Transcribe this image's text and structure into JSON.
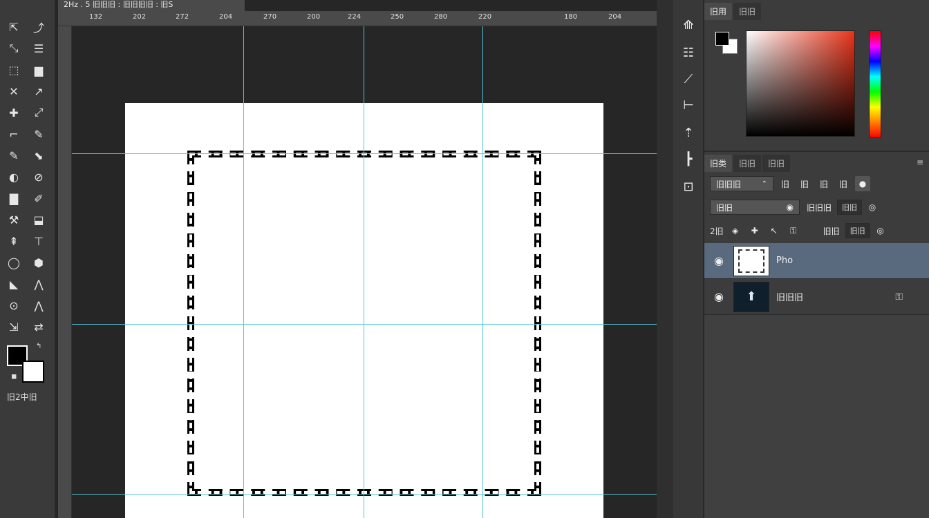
{
  "document": {
    "tab_title": "2Hz . 5 旧旧旧 : 旧旧旧旧 : 旧S"
  },
  "rulers": {
    "top_labels": [
      "132",
      "202",
      "272",
      "204",
      "270",
      "200",
      "224",
      "250",
      "280",
      "220",
      "180",
      "204"
    ]
  },
  "toolbar": {
    "tools_left": [
      "⇱",
      "⤡",
      "⬚",
      "✕",
      "✚",
      "⌐",
      "✎",
      "◐",
      "▇",
      "⚒",
      "⇞",
      "◯",
      "◣",
      "⊙",
      "⇲"
    ],
    "tools_right": [
      "⤴",
      "☰",
      "▆",
      "↗",
      "⤢",
      "✎",
      "⬊",
      "⊘",
      "✐",
      "⬓",
      "⊤",
      "⬢",
      "⋀",
      "⋀",
      "⇄"
    ],
    "quick_mask_label": "旧2中旧"
  },
  "colors": {
    "foreground": "#000000",
    "background": "#ffffff",
    "guide": "#52c8d8",
    "selected_layer": "#5a6a7e"
  },
  "icon_column": {
    "buttons": [
      "⟰",
      "☷",
      "⟋",
      "⊢",
      "⇡",
      "┣",
      "⊡"
    ]
  },
  "color_panel": {
    "tabs": [
      "旧用",
      "旧旧"
    ]
  },
  "layers_panel": {
    "tabs": [
      "旧类",
      "旧旧",
      "旧旧"
    ],
    "menu_icon": "≡",
    "kind_filter": "旧旧旧",
    "filter_icons": [
      "旧",
      "旧",
      "旧",
      "旧"
    ],
    "blend_mode": "旧旧",
    "opacity_label": "旧旧旧",
    "opacity_value": "旧旧",
    "lock_label": "2旧",
    "lock_icons": [
      "◈",
      "✚",
      "↖",
      "⚿"
    ],
    "fill_label": "旧旧",
    "fill_value": "旧旧",
    "layers": [
      {
        "name": "Pho",
        "visible": true,
        "selected": true,
        "thumb": "white-selection"
      },
      {
        "name": "旧旧旧",
        "visible": true,
        "selected": false,
        "thumb": "dark-icon",
        "locked": true
      }
    ]
  }
}
